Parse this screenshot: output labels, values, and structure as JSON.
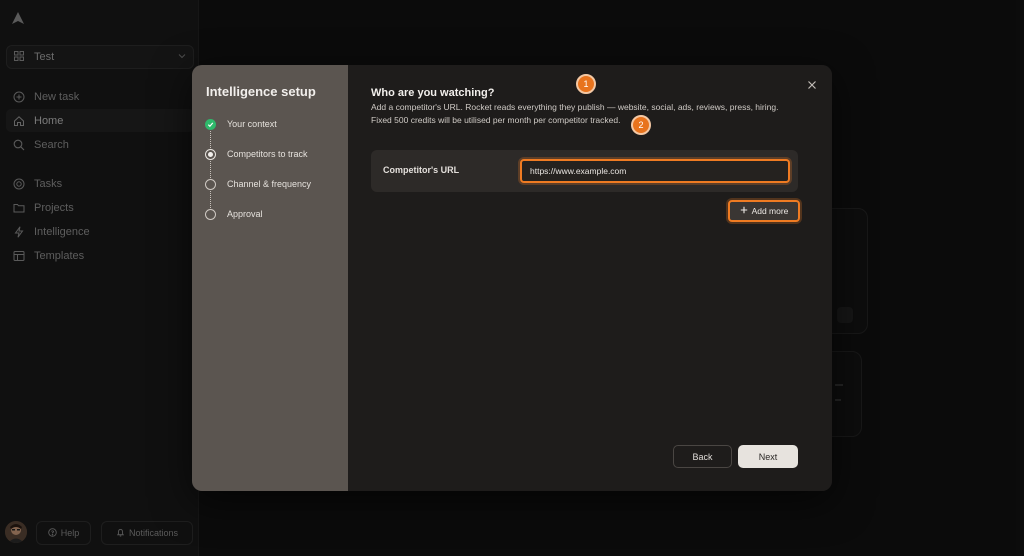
{
  "sidebar": {
    "workspace": "Test",
    "items": [
      {
        "label": "New task",
        "icon": "plus-circle-icon"
      },
      {
        "label": "Home",
        "icon": "home-icon"
      },
      {
        "label": "Search",
        "icon": "search-icon"
      },
      {
        "label": "Tasks",
        "icon": "target-icon"
      },
      {
        "label": "Projects",
        "icon": "folder-icon"
      },
      {
        "label": "Intelligence",
        "icon": "bolt-icon"
      },
      {
        "label": "Templates",
        "icon": "template-icon"
      }
    ],
    "help_label": "Help",
    "notifications_label": "Notifications"
  },
  "modal": {
    "title": "Intelligence setup",
    "steps": [
      {
        "label": "Your context",
        "state": "done"
      },
      {
        "label": "Competitors to track",
        "state": "current"
      },
      {
        "label": "Channel & frequency",
        "state": "todo"
      },
      {
        "label": "Approval",
        "state": "todo"
      }
    ],
    "heading": "Who are you watching?",
    "description": "Add a competitor's URL. Rocket reads everything they publish — website, social, ads, reviews, press, hiring. Fixed 500 credits will be utilised per month per competitor tracked.",
    "url_label": "Competitor's URL",
    "url_value": "https://www.example.com",
    "add_more_label": "Add more",
    "badge_1": "1",
    "badge_2": "2",
    "back_label": "Back",
    "next_label": "Next"
  },
  "colors": {
    "accent": "#ef7b22",
    "step_done": "#2fb96b",
    "modal_left_bg": "#5b5550"
  }
}
